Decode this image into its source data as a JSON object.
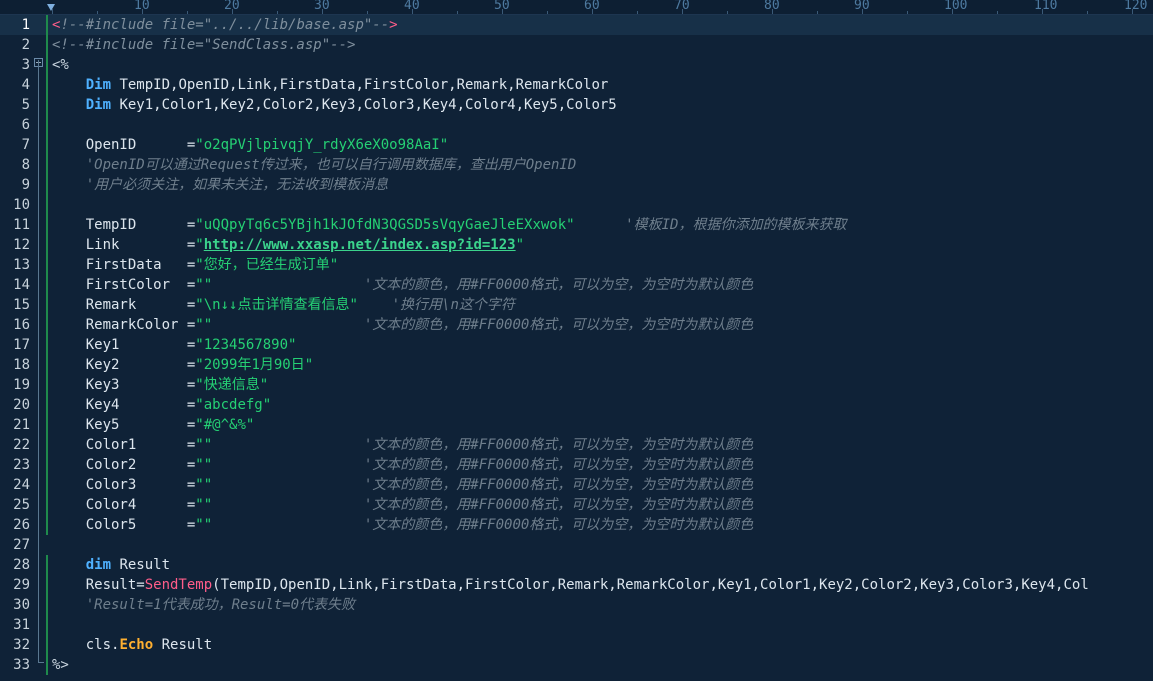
{
  "editor": {
    "ruler_marks": [
      "10",
      "20",
      "30",
      "40",
      "50",
      "60",
      "70",
      "80",
      "90",
      "100",
      "110",
      "120"
    ],
    "current_line": 1,
    "lines": [
      {
        "n": "1",
        "tokens": [
          {
            "c": "t-br",
            "t": "<"
          },
          {
            "c": "t-tag",
            "t": "!--#include file=\"../../lib/base.asp\"--"
          },
          {
            "c": "t-br",
            "t": ">"
          }
        ]
      },
      {
        "n": "2",
        "tokens": [
          {
            "c": "t-tag",
            "t": "<!--#include file=\"SendClass.asp\"-->"
          }
        ]
      },
      {
        "n": "3",
        "tokens": [
          {
            "c": "t-delim",
            "t": "<%"
          }
        ]
      },
      {
        "n": "4",
        "tokens": [
          {
            "c": "t-pl",
            "t": "    "
          },
          {
            "c": "t-kw",
            "t": "Dim"
          },
          {
            "c": "t-pl",
            "t": " TempID,OpenID,Link,FirstData,FirstColor,Remark,RemarkColor"
          }
        ]
      },
      {
        "n": "5",
        "tokens": [
          {
            "c": "t-pl",
            "t": "    "
          },
          {
            "c": "t-kw",
            "t": "Dim"
          },
          {
            "c": "t-pl",
            "t": " Key1,Color1,Key2,Color2,Key3,Color3,Key4,Color4,Key5,Color5"
          }
        ]
      },
      {
        "n": "6",
        "tokens": []
      },
      {
        "n": "7",
        "tokens": [
          {
            "c": "t-pl",
            "t": "    OpenID      ="
          },
          {
            "c": "t-str",
            "t": "\"o2qPVjlpivqjY_rdyX6eX0o98AaI\""
          }
        ]
      },
      {
        "n": "8",
        "tokens": [
          {
            "c": "t-pl",
            "t": "    "
          },
          {
            "c": "t-cm",
            "t": "'OpenID可以通过Request传过来，也可以自行调用数据库，查出用户OpenID"
          }
        ]
      },
      {
        "n": "9",
        "tokens": [
          {
            "c": "t-pl",
            "t": "    "
          },
          {
            "c": "t-cm",
            "t": "'用户必须关注，如果未关注，无法收到模板消息"
          }
        ]
      },
      {
        "n": "10",
        "tokens": []
      },
      {
        "n": "11",
        "tokens": [
          {
            "c": "t-pl",
            "t": "    TempID      ="
          },
          {
            "c": "t-str",
            "t": "\"uQQpyTq6c5YBjh1kJOfdN3QGSD5sVqyGaeJleEXxwok\""
          },
          {
            "c": "t-pl",
            "t": "      "
          },
          {
            "c": "t-cm",
            "t": "'模板ID，根据你添加的模板来获取"
          }
        ]
      },
      {
        "n": "12",
        "tokens": [
          {
            "c": "t-pl",
            "t": "    Link        ="
          },
          {
            "c": "t-str",
            "t": "\""
          },
          {
            "c": "t-url",
            "t": "http://www.xxasp.net/index.asp?id=123"
          },
          {
            "c": "t-str",
            "t": "\""
          }
        ]
      },
      {
        "n": "13",
        "tokens": [
          {
            "c": "t-pl",
            "t": "    FirstData   ="
          },
          {
            "c": "t-str",
            "t": "\"您好，已经生成订单\""
          }
        ]
      },
      {
        "n": "14",
        "tokens": [
          {
            "c": "t-pl",
            "t": "    FirstColor  ="
          },
          {
            "c": "t-str",
            "t": "\"\""
          },
          {
            "c": "t-pl",
            "t": "                  "
          },
          {
            "c": "t-cm",
            "t": "'文本的颜色，用#FF0000格式，可以为空，为空时为默认颜色"
          }
        ]
      },
      {
        "n": "15",
        "tokens": [
          {
            "c": "t-pl",
            "t": "    Remark      ="
          },
          {
            "c": "t-str",
            "t": "\"\\n↓↓点击详情查看信息\""
          },
          {
            "c": "t-pl",
            "t": "    "
          },
          {
            "c": "t-cm",
            "t": "'换行用\\n这个字符"
          }
        ]
      },
      {
        "n": "16",
        "tokens": [
          {
            "c": "t-pl",
            "t": "    RemarkColor ="
          },
          {
            "c": "t-str",
            "t": "\"\""
          },
          {
            "c": "t-pl",
            "t": "                  "
          },
          {
            "c": "t-cm",
            "t": "'文本的颜色，用#FF0000格式，可以为空，为空时为默认颜色"
          }
        ]
      },
      {
        "n": "17",
        "tokens": [
          {
            "c": "t-pl",
            "t": "    Key1        ="
          },
          {
            "c": "t-str",
            "t": "\"1234567890\""
          }
        ]
      },
      {
        "n": "18",
        "tokens": [
          {
            "c": "t-pl",
            "t": "    Key2        ="
          },
          {
            "c": "t-str",
            "t": "\"2099年1月90日\""
          }
        ]
      },
      {
        "n": "19",
        "tokens": [
          {
            "c": "t-pl",
            "t": "    Key3        ="
          },
          {
            "c": "t-str",
            "t": "\"快递信息\""
          }
        ]
      },
      {
        "n": "20",
        "tokens": [
          {
            "c": "t-pl",
            "t": "    Key4        ="
          },
          {
            "c": "t-str",
            "t": "\"abcdefg\""
          }
        ]
      },
      {
        "n": "21",
        "tokens": [
          {
            "c": "t-pl",
            "t": "    Key5        ="
          },
          {
            "c": "t-str",
            "t": "\"#@^&%\""
          }
        ]
      },
      {
        "n": "22",
        "tokens": [
          {
            "c": "t-pl",
            "t": "    Color1      ="
          },
          {
            "c": "t-str",
            "t": "\"\""
          },
          {
            "c": "t-pl",
            "t": "                  "
          },
          {
            "c": "t-cm",
            "t": "'文本的颜色，用#FF0000格式，可以为空，为空时为默认颜色"
          }
        ]
      },
      {
        "n": "23",
        "tokens": [
          {
            "c": "t-pl",
            "t": "    Color2      ="
          },
          {
            "c": "t-str",
            "t": "\"\""
          },
          {
            "c": "t-pl",
            "t": "                  "
          },
          {
            "c": "t-cm",
            "t": "'文本的颜色，用#FF0000格式，可以为空，为空时为默认颜色"
          }
        ]
      },
      {
        "n": "24",
        "tokens": [
          {
            "c": "t-pl",
            "t": "    Color3      ="
          },
          {
            "c": "t-str",
            "t": "\"\""
          },
          {
            "c": "t-pl",
            "t": "                  "
          },
          {
            "c": "t-cm",
            "t": "'文本的颜色，用#FF0000格式，可以为空，为空时为默认颜色"
          }
        ]
      },
      {
        "n": "25",
        "tokens": [
          {
            "c": "t-pl",
            "t": "    Color4      ="
          },
          {
            "c": "t-str",
            "t": "\"\""
          },
          {
            "c": "t-pl",
            "t": "                  "
          },
          {
            "c": "t-cm",
            "t": "'文本的颜色，用#FF0000格式，可以为空，为空时为默认颜色"
          }
        ]
      },
      {
        "n": "26",
        "tokens": [
          {
            "c": "t-pl",
            "t": "    Color5      ="
          },
          {
            "c": "t-str",
            "t": "\"\""
          },
          {
            "c": "t-pl",
            "t": "                  "
          },
          {
            "c": "t-cm",
            "t": "'文本的颜色，用#FF0000格式，可以为空，为空时为默认颜色"
          }
        ]
      },
      {
        "n": "27",
        "tokens": []
      },
      {
        "n": "28",
        "tokens": [
          {
            "c": "t-pl",
            "t": "    "
          },
          {
            "c": "t-kw",
            "t": "dim"
          },
          {
            "c": "t-pl",
            "t": " Result"
          }
        ]
      },
      {
        "n": "29",
        "tokens": [
          {
            "c": "t-pl",
            "t": "    Result="
          },
          {
            "c": "t-fn",
            "t": "SendTemp"
          },
          {
            "c": "t-pl",
            "t": "(TempID,OpenID,Link,FirstData,FirstColor,Remark,RemarkColor,Key1,Color1,Key2,Color2,Key3,Color3,Key4,Col"
          }
        ]
      },
      {
        "n": "30",
        "tokens": [
          {
            "c": "t-pl",
            "t": "    "
          },
          {
            "c": "t-cm",
            "t": "'Result=1代表成功，Result=0代表失败"
          }
        ]
      },
      {
        "n": "31",
        "tokens": []
      },
      {
        "n": "32",
        "tokens": [
          {
            "c": "t-pl",
            "t": "    cls."
          },
          {
            "c": "t-ob",
            "t": "Echo"
          },
          {
            "c": "t-pl",
            "t": " Result"
          }
        ]
      },
      {
        "n": "33",
        "tokens": [
          {
            "c": "t-delim",
            "t": "%>"
          }
        ]
      }
    ]
  }
}
